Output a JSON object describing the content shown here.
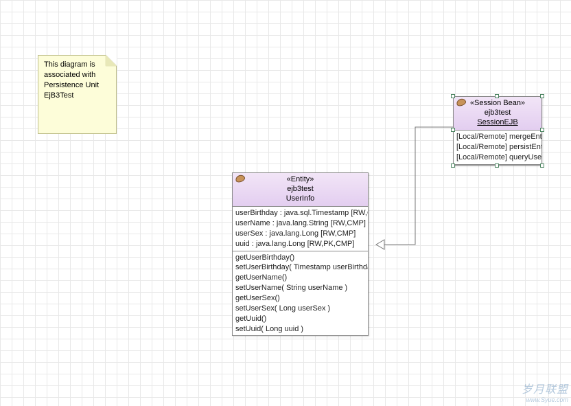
{
  "note": {
    "text": "This diagram is associated with Persistence Unit EjB3Test"
  },
  "entity": {
    "stereotype": "«Entity»",
    "package": "ejb3test",
    "name": "UserInfo",
    "attributes": [
      "userBirthday : java.sql.Timestamp [RW,CMP]",
      "userName : java.lang.String [RW,CMP]",
      "userSex : java.lang.Long [RW,CMP]",
      "uuid : java.lang.Long [RW,PK,CMP]"
    ],
    "operations": [
      "getUserBirthday()",
      "setUserBirthday( Timestamp userBirthday )",
      "getUserName()",
      "setUserName( String userName )",
      "getUserSex()",
      "setUserSex( Long userSex )",
      "getUuid()",
      "setUuid( Long uuid )"
    ]
  },
  "session": {
    "stereotype": "«Session Bean»",
    "package": "ejb3test",
    "name": "SessionEJB",
    "operations": [
      "[Local/Remote] mergeEntity",
      "[Local/Remote] persistEntity",
      "[Local/Remote] queryUserInfo"
    ]
  },
  "watermark": {
    "title": "岁月联盟",
    "url": "www.Syue.com"
  }
}
